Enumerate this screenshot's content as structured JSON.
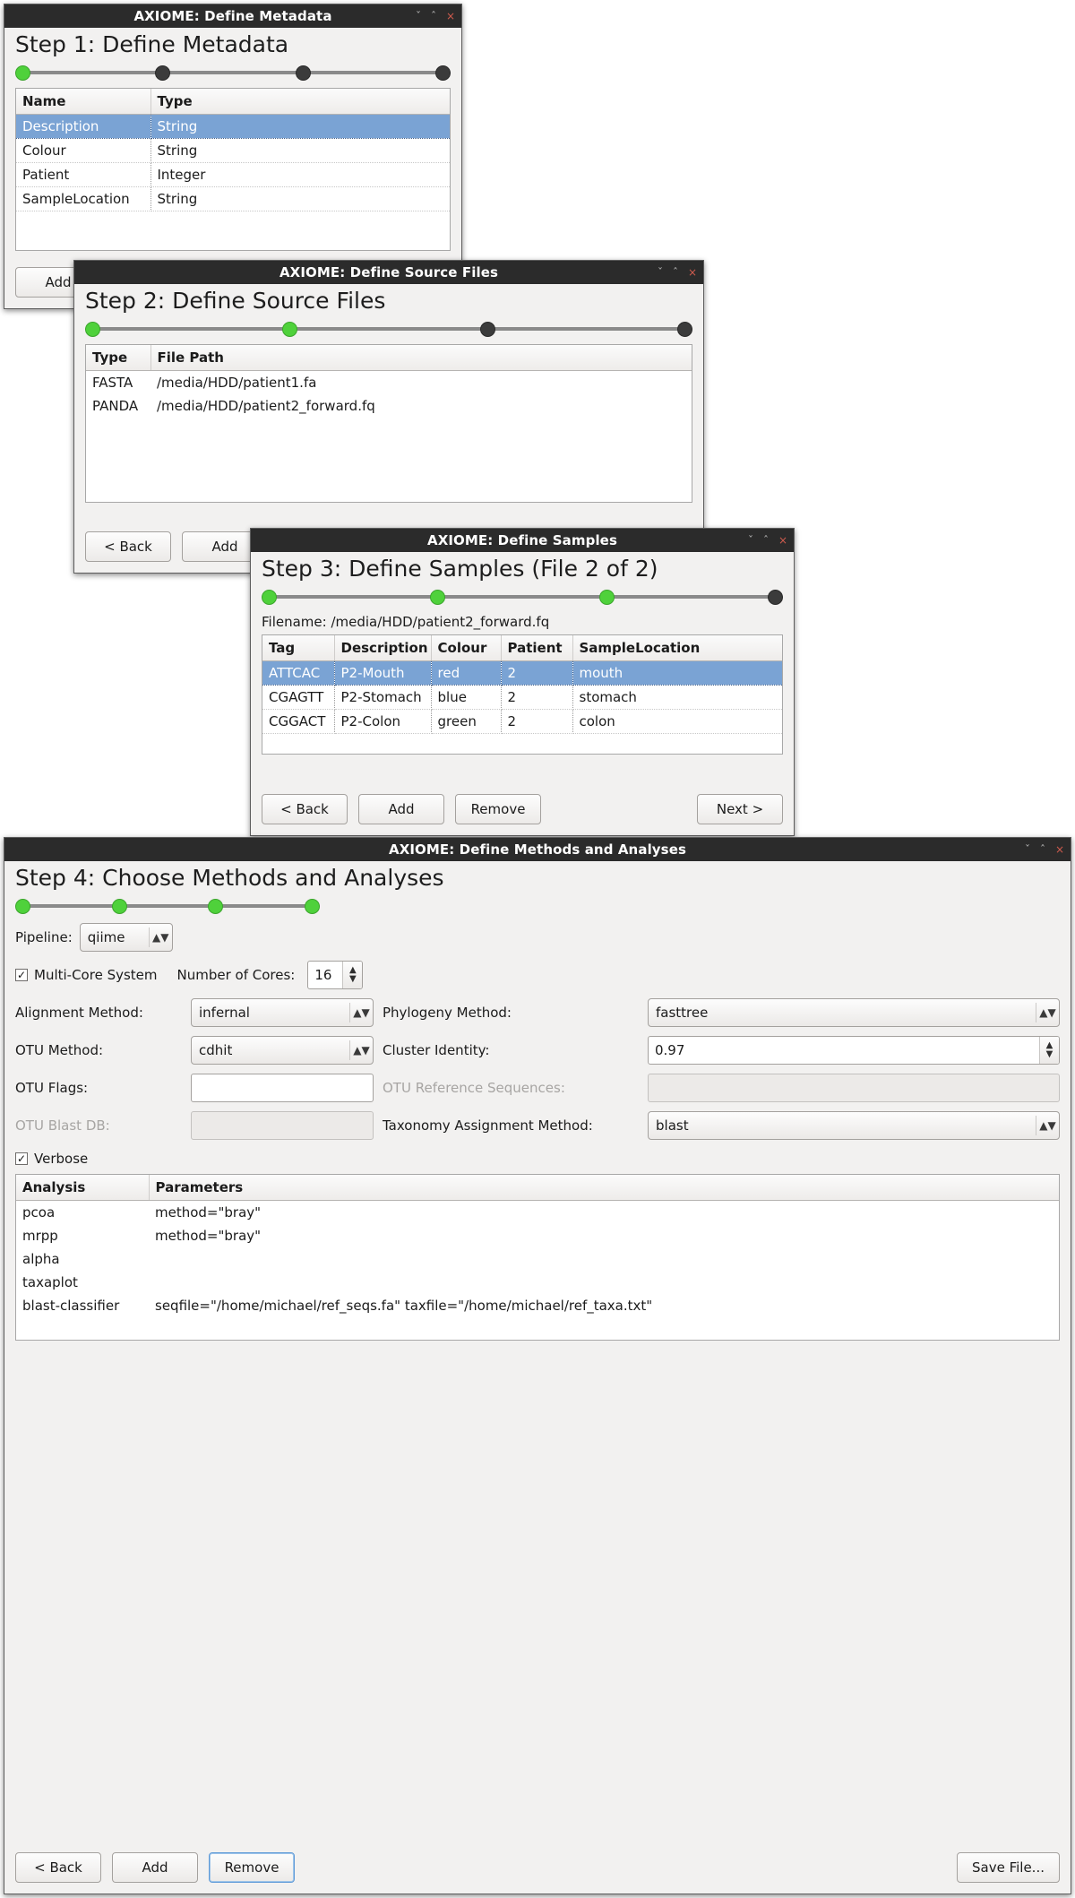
{
  "colors": {
    "titlebar_bg": "#2b2b2b",
    "selection_blue": "#7aa3d4",
    "progress_done": "#4fd13b",
    "progress_todo": "#3b3b3b",
    "close_red": "#cf5b4e"
  },
  "window_controls": {
    "minimize": "ˇ",
    "maximize": "ˆ",
    "close": "×"
  },
  "win1": {
    "title": "AXIOME: Define Metadata",
    "heading": "Step 1: Define Metadata",
    "progress": [
      true,
      false,
      false,
      false
    ],
    "table": {
      "columns": [
        "Name",
        "Type"
      ],
      "rows": [
        {
          "cells": [
            "Description",
            "String"
          ],
          "selected": true
        },
        {
          "cells": [
            "Colour",
            "String"
          ],
          "selected": false
        },
        {
          "cells": [
            "Patient",
            "Integer"
          ],
          "selected": false
        },
        {
          "cells": [
            "SampleLocation",
            "String"
          ],
          "selected": false
        }
      ]
    },
    "buttons": [
      "Add"
    ]
  },
  "win2": {
    "title": "AXIOME: Define Source Files",
    "heading": "Step 2: Define Source Files",
    "progress": [
      true,
      true,
      false,
      false
    ],
    "table": {
      "columns": [
        "Type",
        "File Path"
      ],
      "rows": [
        {
          "cells": [
            "FASTA",
            "/media/HDD/patient1.fa"
          ],
          "selected": false
        },
        {
          "cells": [
            "PANDA",
            "/media/HDD/patient2_forward.fq"
          ],
          "selected": false
        }
      ]
    },
    "buttons": [
      "< Back",
      "Add"
    ]
  },
  "win3": {
    "title": "AXIOME: Define Samples",
    "heading": "Step 3: Define Samples (File 2 of 2)",
    "progress": [
      true,
      true,
      true,
      false
    ],
    "filename_label": "Filename: /media/HDD/patient2_forward.fq",
    "table": {
      "columns": [
        "Tag",
        "Description",
        "Colour",
        "Patient",
        "SampleLocation"
      ],
      "rows": [
        {
          "cells": [
            "ATTCAC",
            "P2-Mouth",
            "red",
            "2",
            "mouth"
          ],
          "selected": true
        },
        {
          "cells": [
            "CGAGTT",
            "P2-Stomach",
            "blue",
            "2",
            "stomach"
          ],
          "selected": false
        },
        {
          "cells": [
            "CGGACT",
            "P2-Colon",
            "green",
            "2",
            "colon"
          ],
          "selected": false
        }
      ]
    },
    "buttons": [
      "< Back",
      "Add",
      "Remove",
      "Next >"
    ]
  },
  "win4": {
    "title": "AXIOME: Define Methods and Analyses",
    "heading": "Step 4: Choose Methods and Analyses",
    "progress": [
      true,
      true,
      true,
      true
    ],
    "form": {
      "pipeline_label": "Pipeline:",
      "pipeline_value": "qiime",
      "multicore_label": "Multi-Core System",
      "multicore_checked": "✓",
      "cores_label": "Number of Cores:",
      "cores_value": "16",
      "alignment_label": "Alignment Method:",
      "alignment_value": "infernal",
      "phylogeny_label": "Phylogeny Method:",
      "phylogeny_value": "fasttree",
      "otu_method_label": "OTU Method:",
      "otu_method_value": "cdhit",
      "cluster_identity_label": "Cluster Identity:",
      "cluster_identity_value": "0.97",
      "otu_flags_label": "OTU Flags:",
      "otu_flags_value": "",
      "otu_refseq_label": "OTU Reference Sequences:",
      "otu_refseq_value": "",
      "otu_blastdb_label": "OTU Blast DB:",
      "otu_blastdb_value": "",
      "taxonomy_label": "Taxonomy Assignment Method:",
      "taxonomy_value": "blast",
      "verbose_label": "Verbose",
      "verbose_checked": "✓"
    },
    "analysis_table": {
      "columns": [
        "Analysis",
        "Parameters"
      ],
      "rows": [
        {
          "cells": [
            "pcoa",
            "method=\"bray\""
          ]
        },
        {
          "cells": [
            "mrpp",
            "method=\"bray\""
          ]
        },
        {
          "cells": [
            "alpha",
            ""
          ]
        },
        {
          "cells": [
            "taxaplot",
            ""
          ]
        },
        {
          "cells": [
            "blast-classifier",
            "seqfile=\"/home/michael/ref_seqs.fa\" taxfile=\"/home/michael/ref_taxa.txt\""
          ]
        }
      ]
    },
    "buttons": {
      "back": "< Back",
      "add": "Add",
      "remove": "Remove",
      "save": "Save File..."
    }
  }
}
